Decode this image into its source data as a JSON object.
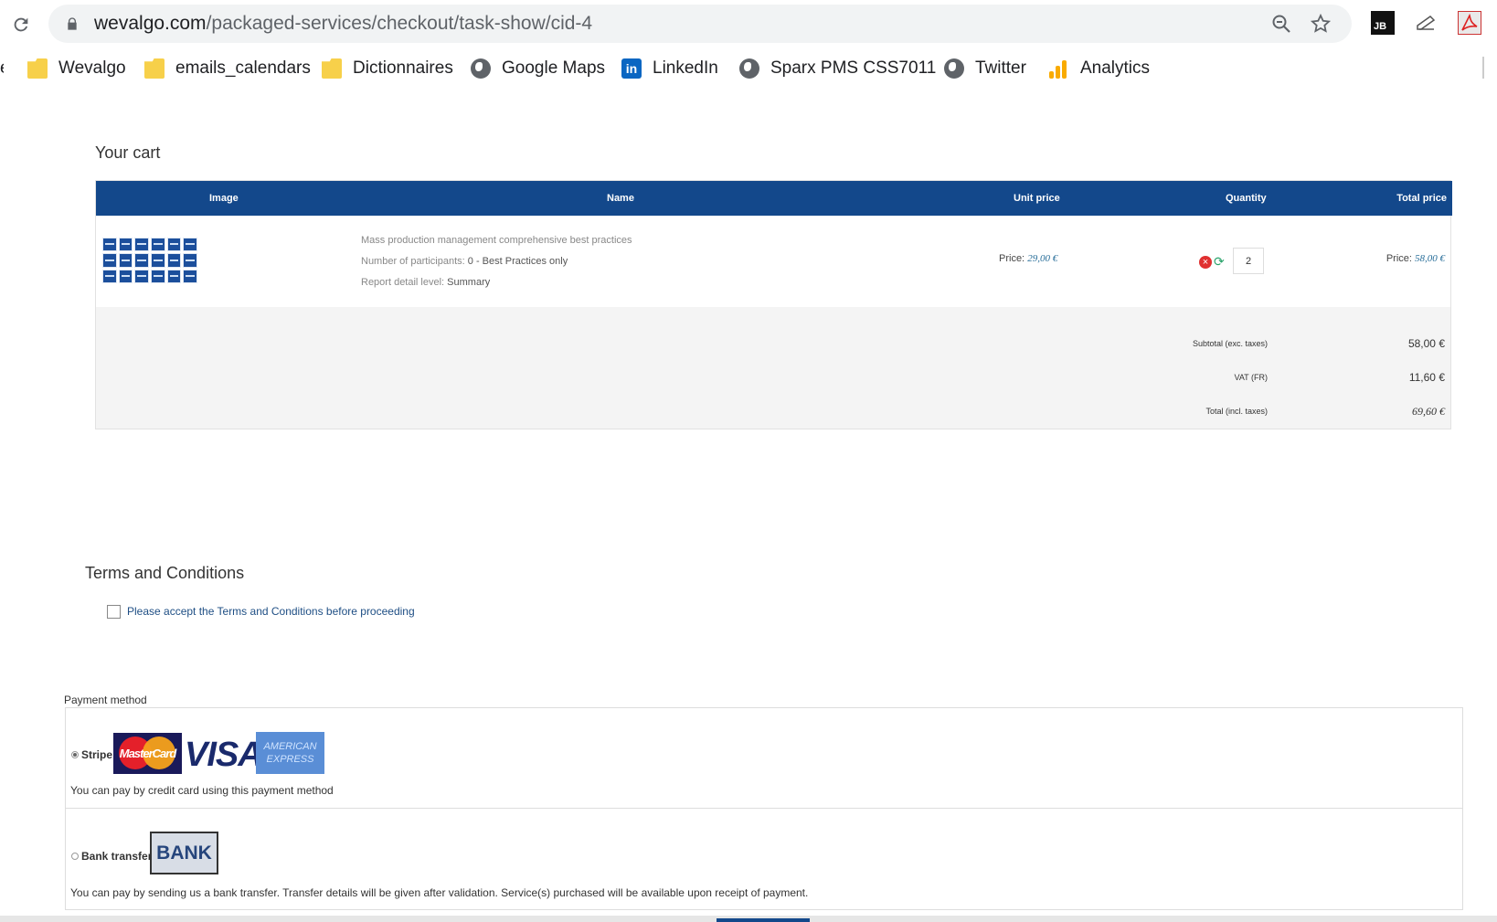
{
  "browser": {
    "url_host": "wevalgo.com",
    "url_path": "/packaged-services/checkout/task-show/cid-4",
    "bookmarks": [
      "Wevalgo",
      "emails_calendars",
      "Dictionnaires",
      "Google Maps",
      "LinkedIn",
      "Sparx PMS CSS7011",
      "Twitter",
      "Analytics"
    ],
    "ext_jb": "JB"
  },
  "cart": {
    "title": "Your cart",
    "headers": {
      "image": "Image",
      "name": "Name",
      "unit_price": "Unit price",
      "quantity": "Quantity",
      "total_price": "Total price"
    },
    "item": {
      "name": "Mass production management comprehensive best practices",
      "participants_label": "Number of participants:",
      "participants_value": "0 - Best Practices only",
      "report_label": "Report detail level:",
      "report_value": "Summary",
      "unit_price_label": "Price:",
      "unit_price_value": "29,00 €",
      "quantity": "2",
      "total_price_label": "Price:",
      "total_price_value": "58,00 €"
    },
    "summary": {
      "subtotal_label": "Subtotal (exc. taxes)",
      "subtotal_value": "58,00 €",
      "vat_label": "VAT (FR)",
      "vat_value": "11,60 €",
      "total_label": "Total (incl. taxes)",
      "total_value": "69,60 €"
    }
  },
  "terms": {
    "title": "Terms and Conditions",
    "checkbox_text": "Please accept the Terms and Conditions before proceeding",
    "checked": false
  },
  "payment": {
    "label": "Payment method",
    "methods": [
      {
        "name": "Stripe",
        "selected": true,
        "description": "You can pay by credit card using this payment method",
        "logos": [
          "MasterCard",
          "VISA",
          "AMERICAN EXPRESS"
        ]
      },
      {
        "name": "Bank transfer",
        "selected": false,
        "description": "You can pay by sending us a bank transfer. Transfer details will be given after validation. Service(s) purchased will be available upon receipt of payment.",
        "logo": "BANK"
      }
    ]
  },
  "colors": {
    "header_blue": "#13488b",
    "price_blue": "#2a6f9a",
    "link_blue": "#1e4e84"
  }
}
